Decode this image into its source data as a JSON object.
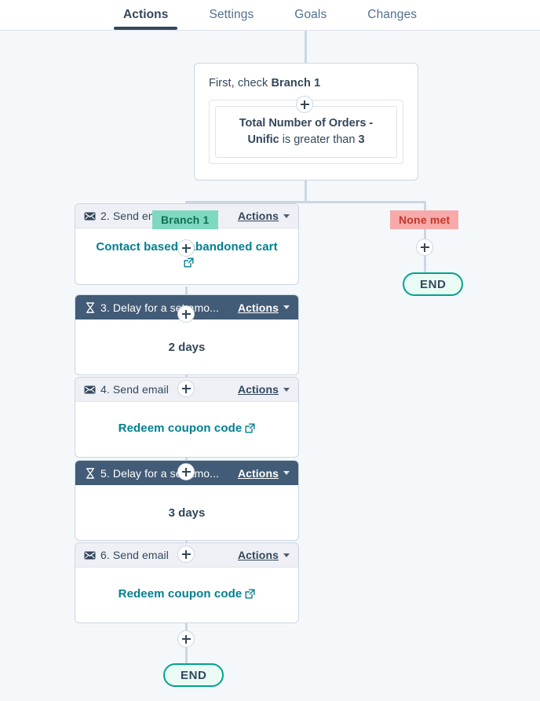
{
  "tabs": [
    {
      "label": "Actions",
      "active": true
    },
    {
      "label": "Settings",
      "active": false
    },
    {
      "label": "Goals",
      "active": false
    },
    {
      "label": "Changes",
      "active": false
    }
  ],
  "branch": {
    "title_prefix": "First, check ",
    "title_name": "Branch 1",
    "condition_property": "Total Number of Orders - Unific",
    "condition_operator": " is greater than ",
    "condition_value": "3"
  },
  "badges": {
    "branch_label": "Branch 1",
    "none_met_label": "None met"
  },
  "actions_menu_label": "Actions",
  "end_label": "END",
  "steps": [
    {
      "id": "step-2",
      "icon": "email-icon",
      "title": "2. Send email",
      "style": "light",
      "body_text": "Contact based - abandoned cart",
      "body_type": "link"
    },
    {
      "id": "step-3",
      "icon": "hourglass-icon",
      "title": "3. Delay for a set amo...",
      "style": "dark",
      "body_text": "2 days",
      "body_type": "plain"
    },
    {
      "id": "step-4",
      "icon": "email-icon",
      "title": "4. Send email",
      "style": "light",
      "body_text": "Redeem coupon code",
      "body_type": "link"
    },
    {
      "id": "step-5",
      "icon": "hourglass-icon",
      "title": "5. Delay for a set amo...",
      "style": "dark",
      "body_text": "3 days",
      "body_type": "plain"
    },
    {
      "id": "step-6",
      "icon": "email-icon",
      "title": "6. Send email",
      "style": "light",
      "body_text": "Redeem coupon code",
      "body_type": "link"
    }
  ],
  "colors": {
    "background": "#f5f8fa",
    "connector": "#cbd6e2",
    "dark_header": "#425b76",
    "light_header": "#eef0f6",
    "link": "#00808f",
    "branch_badge_bg": "#7fd9c0",
    "branch_badge_text": "#0e6e56",
    "none_badge_bg": "#f8a9a9",
    "none_badge_text": "#c0392b",
    "end_border": "#00a38d",
    "end_bg": "#eafaf4",
    "tab_active": "#33475b"
  }
}
